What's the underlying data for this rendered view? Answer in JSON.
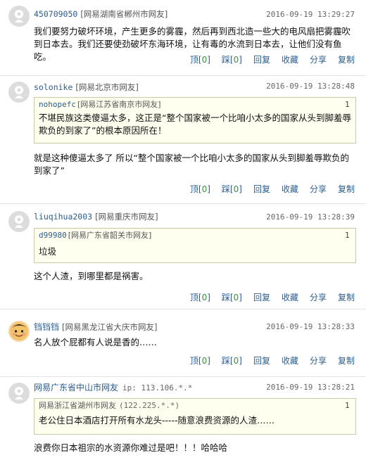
{
  "actions": {
    "top": "顶",
    "down": "踩",
    "reply": "回复",
    "fav": "收藏",
    "share": "分享",
    "copy": "复制",
    "lb": "[",
    "rb": "]"
  },
  "comments": [
    {
      "user": "450709050",
      "location": "[网易湖南省郴州市网友]",
      "time": "2016-09-19 13:29:27",
      "text": "我们要努力破坏环境，产生更多的雾霾，然后再到西北造一些大的电风扇把雾霾吹到日本去。我们还要使劲破坏东海环境，让有毒的水流到日本去，让他们没有鱼吃。",
      "top_count": "0",
      "down_count": "0"
    },
    {
      "user": "solonike",
      "location": "[网易北京市网友]",
      "time": "2016-09-19 13:28:48",
      "quote": {
        "user": "nohopefc",
        "location": "[网易江苏省南京市网友]",
        "floor": "1",
        "text": "不堪民族这类傻逼太多，这正是“整个国家被一个比咱小太多的国家从头到脚羞辱欺负的到家了”的根本原因所在！"
      },
      "text": "就是这种傻逼太多了 所以“整个国家被一个比咱小太多的国家从头到脚羞辱欺负的到家了”",
      "top_count": "0",
      "down_count": "0"
    },
    {
      "user": "liuqihua2003",
      "location": "[网易重庆市网友]",
      "time": "2016-09-19 13:28:39",
      "quote": {
        "user": "d99980",
        "location": "[网易广东省韶关市网友]",
        "floor": "1",
        "text": "垃圾"
      },
      "text": "这个人渣，到哪里都是祸害。",
      "top_count": "0",
      "down_count": "0"
    },
    {
      "user": "铛铛铛",
      "location": "[网易黑龙江省大庆市网友]",
      "time": "2016-09-19 13:28:33",
      "text": "名人放个屁都有人说是香的……",
      "top_count": "0",
      "down_count": "0"
    },
    {
      "user": "网易广东省中山市网友",
      "ip": "ip: 113.106.*.*",
      "time": "2016-09-19 13:28:21",
      "quote": {
        "user": "网易浙江省湖州市网友",
        "ip": "(122.225.*.*)",
        "floor": "1",
        "text": "老公住日本酒店打开所有水龙头-----随意浪费资源的人渣……"
      },
      "text": "浪费你日本祖宗的水资源你难过是吧！！！哈哈哈"
    }
  ]
}
